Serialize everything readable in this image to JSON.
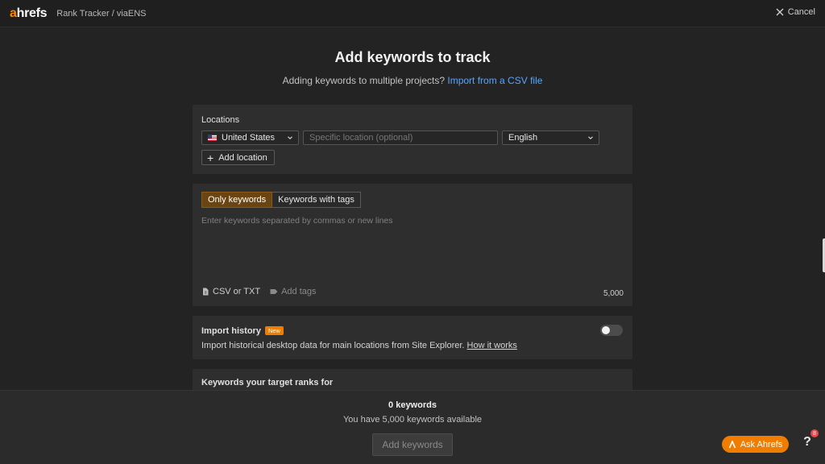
{
  "topbar": {
    "logo_accent": "a",
    "logo_rest": "hrefs",
    "breadcrumb": "Rank Tracker / viaENS",
    "cancel_label": "Cancel"
  },
  "header": {
    "title": "Add keywords to track",
    "subtitle_text": "Adding keywords to multiple projects?",
    "subtitle_link": "Import from a CSV file"
  },
  "locations": {
    "label": "Locations",
    "country": "United States",
    "specific_placeholder": "Specific location (optional)",
    "language": "English",
    "add_location_label": "Add location"
  },
  "keywords": {
    "tabs": [
      {
        "label": "Only keywords",
        "active": true
      },
      {
        "label": "Keywords with tags",
        "active": false
      }
    ],
    "placeholder": "Enter keywords separated by commas or new lines",
    "csv_label": "CSV or TXT",
    "tags_label": "Add tags",
    "limit": "5,000"
  },
  "import_history": {
    "title": "Import history",
    "badge": "New",
    "description": "Import historical desktop data for main locations from Site Explorer.",
    "link": "How it works",
    "enabled": false
  },
  "target_ranks": {
    "title": "Keywords your target ranks for"
  },
  "footer": {
    "count": "0 keywords",
    "available": "You have 5,000 keywords available",
    "add_button": "Add keywords"
  },
  "assistant": {
    "ask_label": "Ask Ahrefs",
    "help_label": "?",
    "help_badge": "8"
  },
  "colors": {
    "accent": "#f07d00",
    "link": "#58a6ff",
    "active_tab": "#6b4511",
    "background": "#232323",
    "card": "#2e2e2e"
  }
}
